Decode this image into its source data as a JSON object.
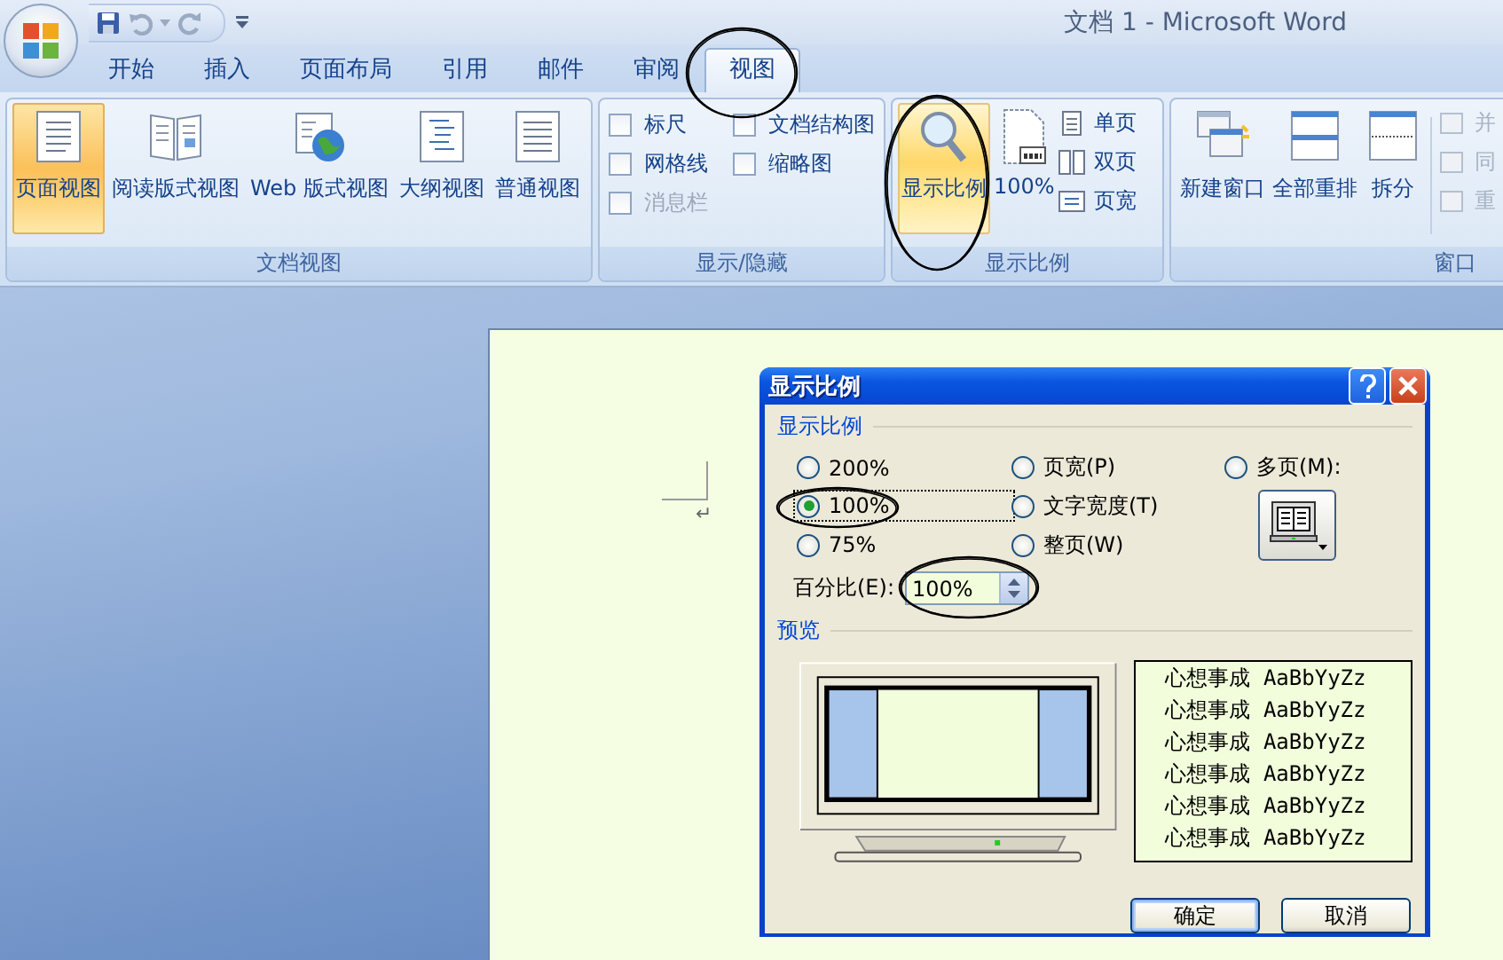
{
  "window": {
    "title": "文档 1 - Microsoft Word"
  },
  "tabs": [
    {
      "label": "开始",
      "selected": false
    },
    {
      "label": "插入",
      "selected": false
    },
    {
      "label": "页面布局",
      "selected": false
    },
    {
      "label": "引用",
      "selected": false
    },
    {
      "label": "邮件",
      "selected": false
    },
    {
      "label": "审阅",
      "selected": false
    },
    {
      "label": "视图",
      "selected": true
    }
  ],
  "ribbon": {
    "groups": [
      {
        "kind": "views",
        "title": "文档视图",
        "items": [
          {
            "label": "页面视图",
            "selected": true
          },
          {
            "label": "阅读版式视图",
            "selected": false
          },
          {
            "label": "Web 版式视图",
            "selected": false
          },
          {
            "label": "大纲视图",
            "selected": false
          },
          {
            "label": "普通视图",
            "selected": false
          }
        ]
      },
      {
        "kind": "checks",
        "title": "显示/隐藏",
        "items": [
          {
            "label": "标尺",
            "checked": false,
            "disabled": false
          },
          {
            "label": "文档结构图",
            "checked": false,
            "disabled": false
          },
          {
            "label": "网格线",
            "checked": false,
            "disabled": false
          },
          {
            "label": "缩略图",
            "checked": false,
            "disabled": false
          },
          {
            "label": "消息栏",
            "checked": false,
            "disabled": true
          }
        ]
      },
      {
        "kind": "zoom",
        "title": "显示比例",
        "large": [
          {
            "label": "显示比例",
            "selected": true
          },
          {
            "label": "100%",
            "selected": false
          }
        ],
        "small": [
          {
            "label": "单页",
            "disabled": false
          },
          {
            "label": "双页",
            "disabled": false
          },
          {
            "label": "页宽",
            "disabled": false
          }
        ]
      },
      {
        "kind": "window",
        "title": "窗口",
        "large": [
          {
            "label": "新建窗口",
            "selected": false
          },
          {
            "label": "全部重排",
            "selected": false
          },
          {
            "label": "拆分",
            "selected": false
          }
        ],
        "small": [
          {
            "label": "并",
            "disabled": true
          },
          {
            "label": "同",
            "disabled": true
          },
          {
            "label": "重",
            "disabled": true
          }
        ]
      }
    ]
  },
  "document": {
    "paragraph_mark": "↵"
  },
  "dialog": {
    "title": "显示比例",
    "zoom_heading": "显示比例",
    "options": [
      {
        "label": "200%",
        "selected": false
      },
      {
        "label": "100%",
        "selected": true
      },
      {
        "label": "75%",
        "selected": false
      },
      {
        "label": "页宽(P)",
        "selected": false
      },
      {
        "label": "文字宽度(T)",
        "selected": false
      },
      {
        "label": "整页(W)",
        "selected": false
      },
      {
        "label": "多页(M):",
        "selected": false
      }
    ],
    "percent": {
      "label": "百分比(E):",
      "value": "100%"
    },
    "preview_heading": "预览",
    "sample_lines": [
      "心想事成 AaBbYyZz",
      "心想事成 AaBbYyZz",
      "心想事成 AaBbYyZz",
      "心想事成 AaBbYyZz",
      "心想事成 AaBbYyZz",
      "心想事成 AaBbYyZz"
    ],
    "buttons": [
      {
        "label": "确定",
        "default": true
      },
      {
        "label": "取消",
        "default": false
      }
    ]
  }
}
